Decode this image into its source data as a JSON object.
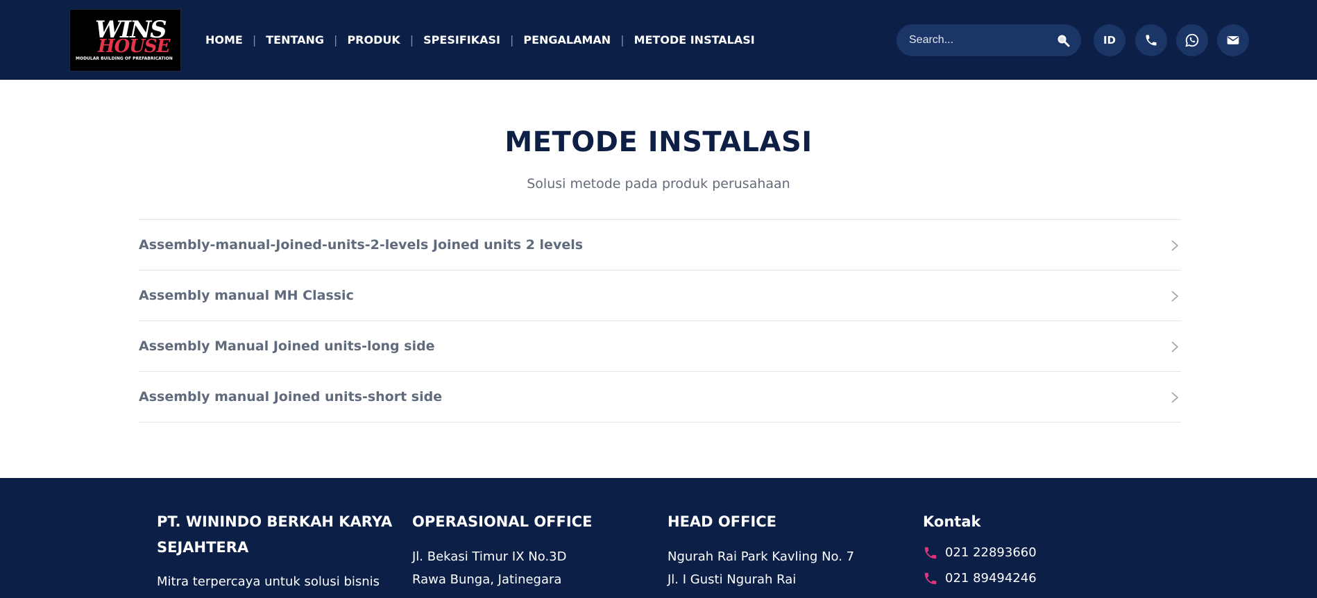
{
  "header": {
    "logo": {
      "wordmark_top": "WINS",
      "wordmark_bottom": "HOUSE",
      "tagline": "MODULAR BUILDING OF PREFABRICATION"
    },
    "nav": [
      "HOME",
      "TENTANG",
      "PRODUK",
      "SPESIFIKASI",
      "PENGALAMAN",
      "METODE INSTALASI"
    ],
    "nav_separator": "|",
    "search": {
      "placeholder": "Search..."
    },
    "language": "ID"
  },
  "main": {
    "title": "METODE INSTALASI",
    "subtitle": "Solusi metode pada produk perusahaan",
    "items": [
      "Assembly-manual-Joined-units-2-levels Joined units 2 levels",
      "Assembly manual MH Classic",
      "Assembly Manual Joined units-long side",
      "Assembly manual Joined units-short side"
    ]
  },
  "footer": {
    "company": {
      "name": "PT. WININDO BERKAH KARYA SEJAHTERA",
      "tagline": "Mitra terpercaya untuk solusi bisnis"
    },
    "operational_office": {
      "heading": "OPERASIONAL OFFICE",
      "lines": [
        "Jl. Bekasi Timur IX No.3D",
        "Rawa Bunga, Jatinegara"
      ]
    },
    "head_office": {
      "heading": "HEAD OFFICE",
      "lines": [
        "Ngurah Rai Park Kavling No. 7",
        "Jl. I Gusti Ngurah Rai"
      ]
    },
    "contact": {
      "heading": "Kontak",
      "phones": [
        "021 22893660",
        "021 89494246"
      ]
    }
  },
  "colors": {
    "navy": "#0b1f47",
    "navy_button": "#1b3567",
    "accent_pink": "#e6354a",
    "phone_icon": "#e0357d"
  }
}
